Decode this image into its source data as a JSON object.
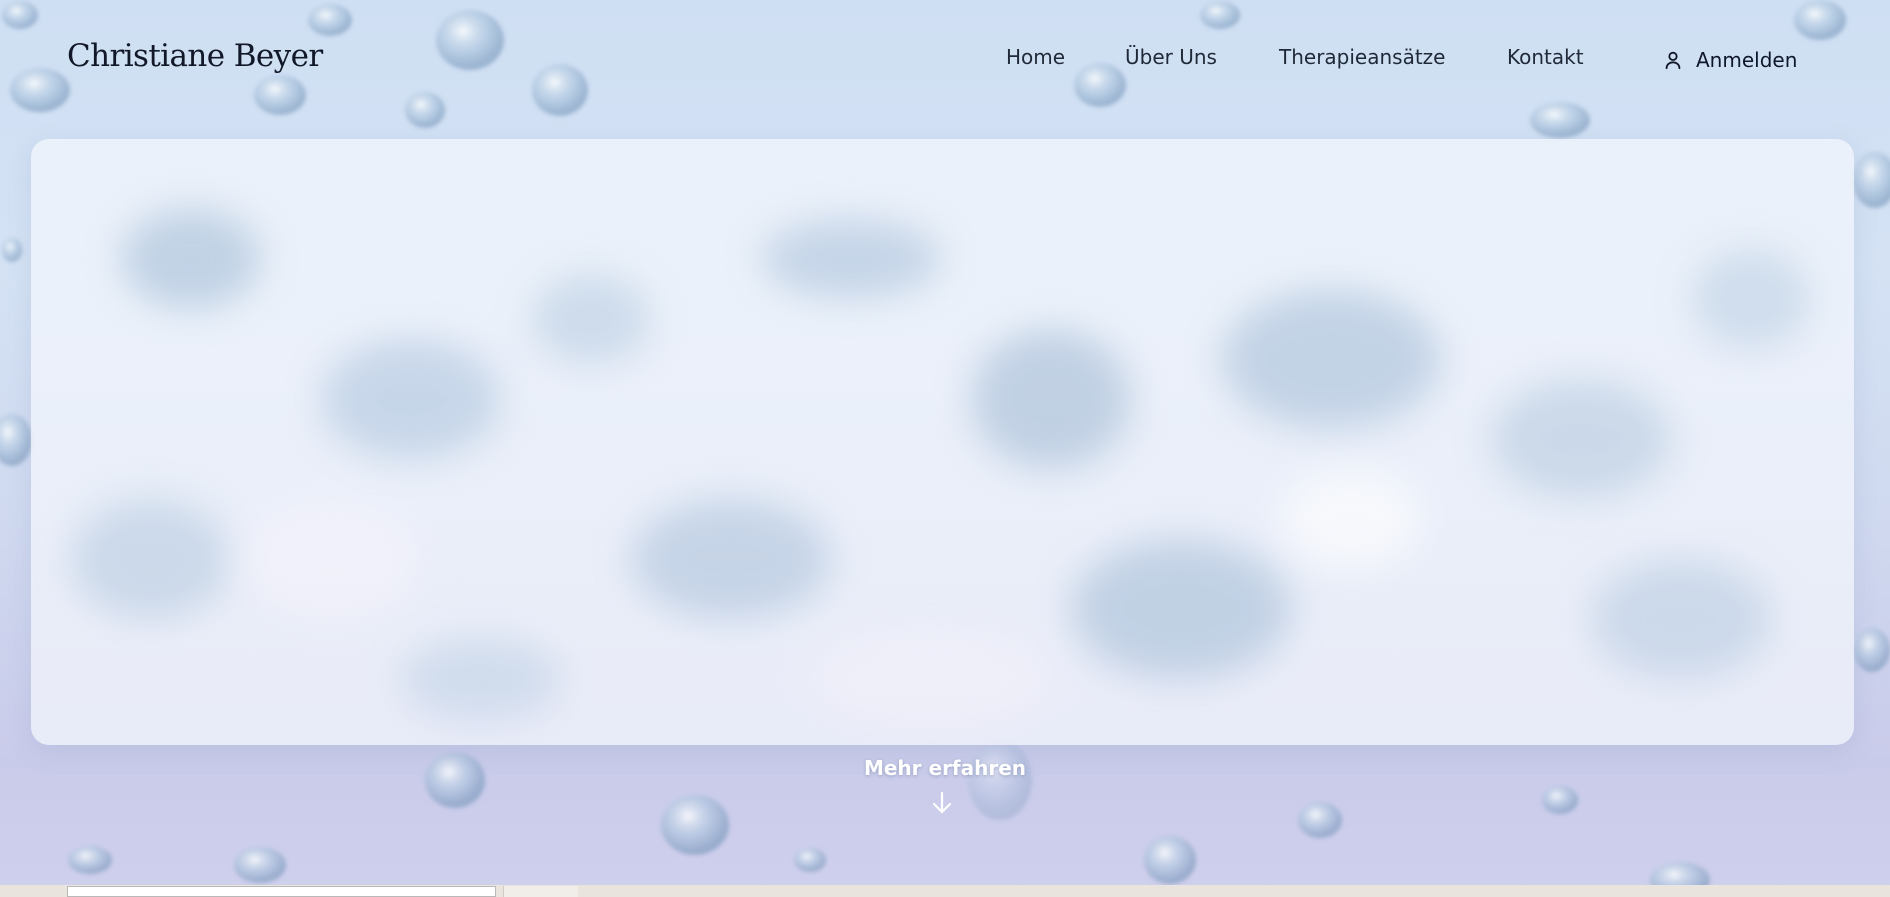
{
  "brand": {
    "name": "Christiane Beyer"
  },
  "nav": {
    "items": [
      {
        "label": "Home",
        "icon": ""
      },
      {
        "label": "Über Uns",
        "icon": ""
      },
      {
        "label": "Therapieansätze",
        "icon": ""
      },
      {
        "label": "Kontakt",
        "icon": ""
      }
    ],
    "login_label": "Anmelden",
    "login_icon": "user-icon"
  },
  "hero": {
    "more_label": "Mehr erfahren",
    "more_icon": "arrow-down-icon"
  },
  "colors": {
    "background_top": "#cfdff3",
    "background_bottom": "#cfd0ec",
    "card": "#f4f7fc",
    "text_dark": "#111827",
    "more_text": "#ffffff"
  }
}
